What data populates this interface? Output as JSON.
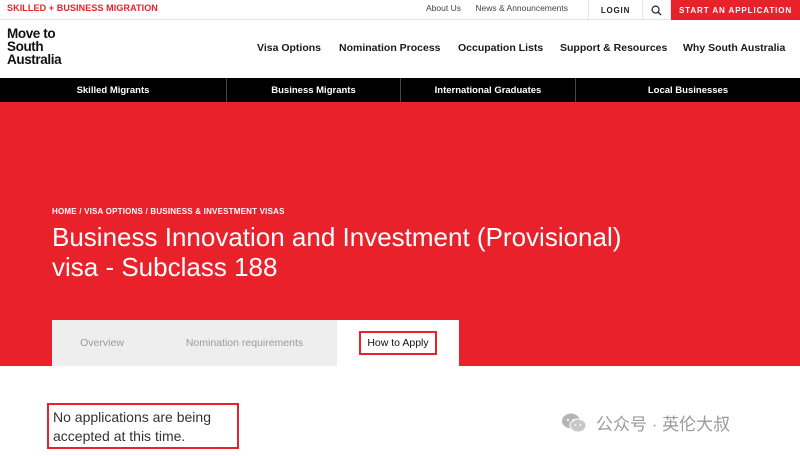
{
  "topbar": {
    "tagline": "SKILLED + BUSINESS MIGRATION",
    "links": [
      "About Us",
      "News & Announcements"
    ],
    "login": "LOGIN",
    "search_icon": "search-icon",
    "start_application": "START AN APPLICATION"
  },
  "logo": {
    "lines": [
      "Move to",
      "South",
      "Australia"
    ]
  },
  "main_nav": [
    "Visa Options",
    "Nomination Process",
    "Occupation Lists",
    "Support & Resources",
    "Why South Australia"
  ],
  "sub_nav": [
    "Skilled Migrants",
    "Business Migrants",
    "International Graduates",
    "Local Businesses"
  ],
  "hero": {
    "breadcrumb": "HOME / VISA OPTIONS / BUSINESS & INVESTMENT VISAS",
    "title_line1": "Business Innovation and Investment (Provisional)",
    "title_line2": "visa - Subclass 188"
  },
  "tabs": [
    "Overview",
    "Nomination requirements",
    "How to Apply"
  ],
  "notice": {
    "line1": "No applications are being",
    "line2": "accepted at this time."
  },
  "watermark": "公众号 · 英伦大叔",
  "colors": {
    "brand_red": "#e8212b",
    "nav_black": "#000000"
  }
}
